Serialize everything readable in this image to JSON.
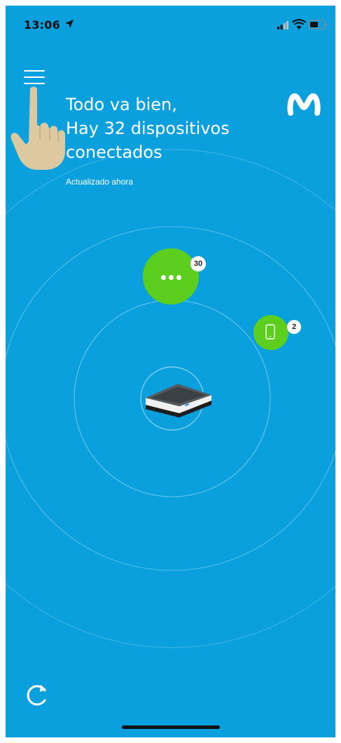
{
  "status_bar": {
    "time": "13:06",
    "icons": [
      "location-arrow-icon",
      "signal-icon",
      "wifi-icon",
      "battery-icon"
    ]
  },
  "header": {
    "menu_icon": "hamburger-menu-icon",
    "headline_lines": [
      "Todo va bien,",
      "Hay 32 dispositivos",
      "conectados"
    ],
    "updated_text": "Actualizado ahora",
    "logo": "movistar-m-logo"
  },
  "network_map": {
    "center_device": "router-image",
    "groups": [
      {
        "icon": "more-dots-icon",
        "count": "30"
      },
      {
        "icon": "smartphone-icon",
        "count": "2"
      }
    ]
  },
  "footer": {
    "refresh_icon": "refresh-icon"
  },
  "colors": {
    "background": "#0aa0de",
    "bubble": "#5ccf1e",
    "text": "#ffffff"
  }
}
